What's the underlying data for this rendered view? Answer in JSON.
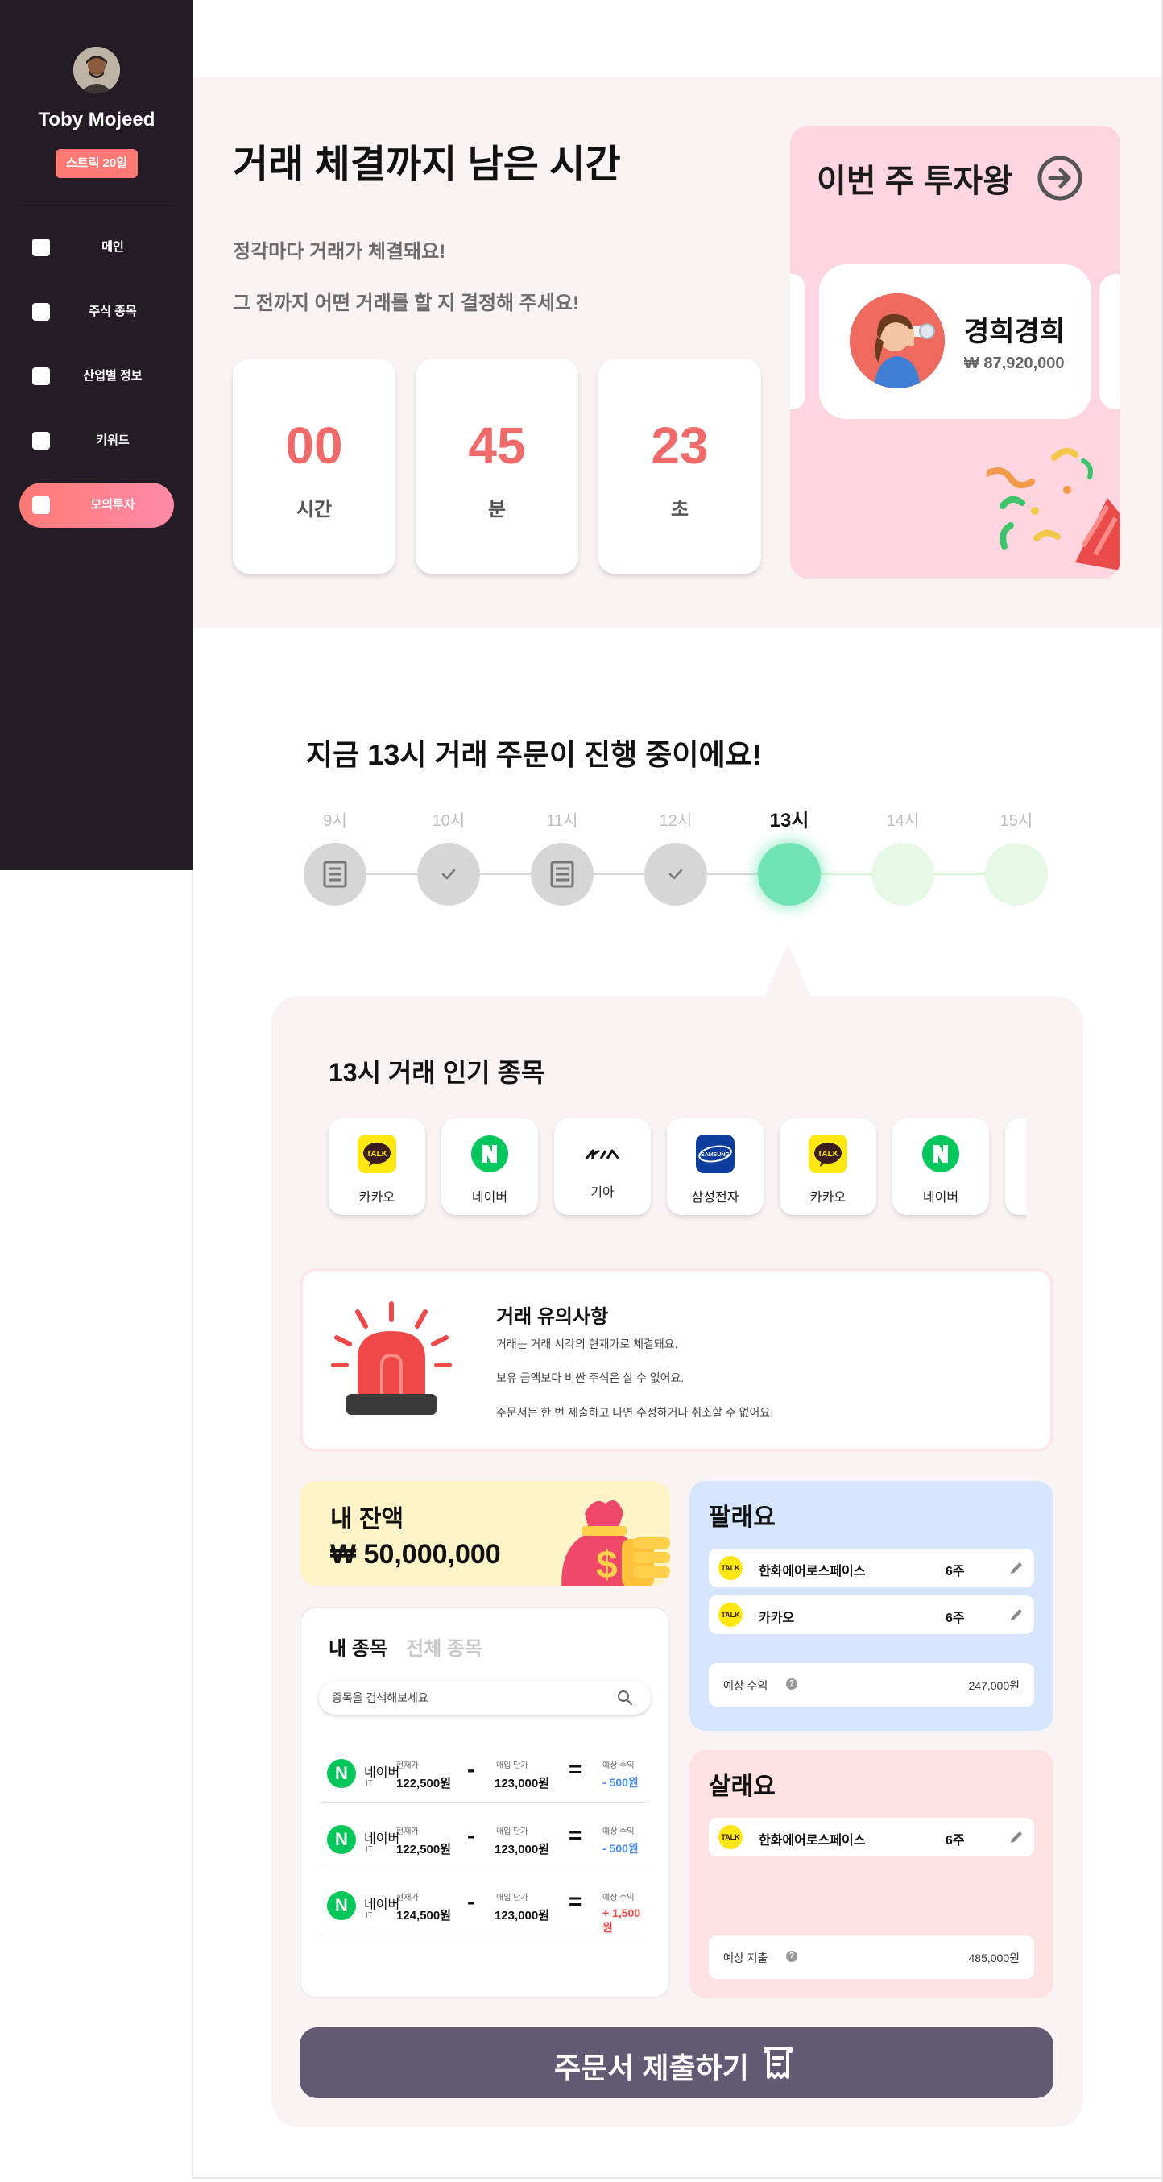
{
  "sidebar": {
    "user_name": "Toby Mojeed",
    "streak": "스트릭 20일",
    "items": [
      {
        "label": "메인"
      },
      {
        "label": "주식 종목"
      },
      {
        "label": "산업별 정보"
      },
      {
        "label": "키워드"
      },
      {
        "label": "모의투자",
        "active": true
      }
    ]
  },
  "countdown": {
    "title": "거래 체결까지 남은 시간",
    "line1": "정각마다 거래가 체결돼요!",
    "line2": "그 전까지 어떤 거래를 할 지 결정해 주세요!",
    "hours": "00",
    "hours_label": "시간",
    "minutes": "45",
    "minutes_label": "분",
    "seconds": "23",
    "seconds_label": "초"
  },
  "weekly_king": {
    "title": "이번 주 투자왕",
    "name": "경희경희",
    "amount": "₩ 87,920,000"
  },
  "timeline": {
    "title": "지금 13시 거래 주문이 진행 중이에요!",
    "hours": [
      {
        "label": "9시",
        "state": "done-list"
      },
      {
        "label": "10시",
        "state": "done-check"
      },
      {
        "label": "11시",
        "state": "done-list"
      },
      {
        "label": "12시",
        "state": "done-check"
      },
      {
        "label": "13시",
        "state": "current"
      },
      {
        "label": "14시",
        "state": "upcoming"
      },
      {
        "label": "15시",
        "state": "upcoming"
      }
    ]
  },
  "popular": {
    "title": "13시 거래 인기 종목",
    "stocks": [
      {
        "name": "카카오",
        "logo": "kakao-talk-logo"
      },
      {
        "name": "네이버",
        "logo": "naver-logo"
      },
      {
        "name": "기아",
        "logo": "kia-logo"
      },
      {
        "name": "삼성전자",
        "logo": "samsung-logo"
      },
      {
        "name": "카카오",
        "logo": "kakao-talk-logo"
      },
      {
        "name": "네이버",
        "logo": "naver-logo"
      }
    ]
  },
  "notice": {
    "title": "거래 유의사항",
    "lines": [
      "거래는 거래 시각의 현재가로 체결돼요.",
      "보유 금액보다 비싼 주식은 살 수 없어요.",
      "주문서는 한 번 제출하고 나면 수정하거나 취소할 수 없어요."
    ]
  },
  "balance": {
    "label": "내 잔액",
    "amount": "₩ 50,000,000"
  },
  "my_stocks": {
    "tab_mine": "내 종목",
    "tab_all": "전체 종목",
    "search_placeholder": "종목을 검색해보세요",
    "rows": [
      {
        "logo": "N",
        "name": "네이버",
        "category": "IT",
        "current_label": "현재가",
        "current": "122,500원",
        "buy_label": "매입 단가",
        "buy": "123,000원",
        "profit_label": "예상 수익",
        "profit": "- 500원",
        "profit_color": "#4a8cf0"
      },
      {
        "logo": "N",
        "name": "네이버",
        "category": "IT",
        "current_label": "현재가",
        "current": "122,500원",
        "buy_label": "매입 단가",
        "buy": "123,000원",
        "profit_label": "예상 수익",
        "profit": "- 500원",
        "profit_color": "#4a8cf0"
      },
      {
        "logo": "N",
        "name": "네이버",
        "category": "IT",
        "current_label": "현재가",
        "current": "124,500원",
        "buy_label": "매입 단가",
        "buy": "123,000원",
        "profit_label": "예상 수익",
        "profit": "+ 1,500원",
        "profit_color": "#f04848"
      }
    ]
  },
  "sell": {
    "title": "팔래요",
    "items": [
      {
        "name": "한화에어로스페이스",
        "qty": "6주"
      },
      {
        "name": "카카오",
        "qty": "6주"
      }
    ],
    "summary_label": "예상 수익",
    "summary_value": "247,000원"
  },
  "buy": {
    "title": "살래요",
    "items": [
      {
        "name": "한화에어로스페이스",
        "qty": "6주"
      }
    ],
    "summary_label": "예상 지출",
    "summary_value": "485,000원"
  },
  "submit": {
    "label": "주문서 제출하기"
  },
  "colors": {
    "accent": "#ff7a75",
    "sidebar_bg": "#241c24",
    "timer_number": "#f06a6a",
    "timeline_current": "#6fe3b4",
    "timeline_upcoming": "#e6f9e6",
    "submit_bg": "#625a72",
    "sell_bg": "#d6e6ff",
    "buy_bg": "#ffe1e1",
    "balance_bg": "#fff3c8"
  }
}
